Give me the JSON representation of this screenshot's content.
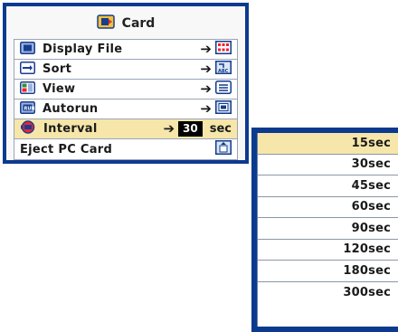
{
  "menu": {
    "title": "Card",
    "items": [
      {
        "label": "Display File",
        "icon": "display-file-icon",
        "target_icon": "grid-icon"
      },
      {
        "label": "Sort",
        "icon": "sort-icon",
        "target_icon": "abc-sort-icon"
      },
      {
        "label": "View",
        "icon": "view-icon",
        "target_icon": "list-icon"
      },
      {
        "label": "Autorun",
        "icon": "autorun-icon",
        "target_icon": "autorun-target-icon"
      },
      {
        "label": "Interval",
        "icon": "interval-icon",
        "value": "30",
        "unit": "sec",
        "selected": true
      },
      {
        "label": "Eject PC Card",
        "icon": "",
        "target_icon": "eject-card-icon"
      }
    ]
  },
  "dropdown": {
    "options": [
      "15sec",
      "30sec",
      "45sec",
      "60sec",
      "90sec",
      "120sec",
      "180sec",
      "300sec"
    ],
    "selected_index": 0
  },
  "colors": {
    "frame": "#0c3a8f",
    "highlight": "#f6e6a9"
  }
}
